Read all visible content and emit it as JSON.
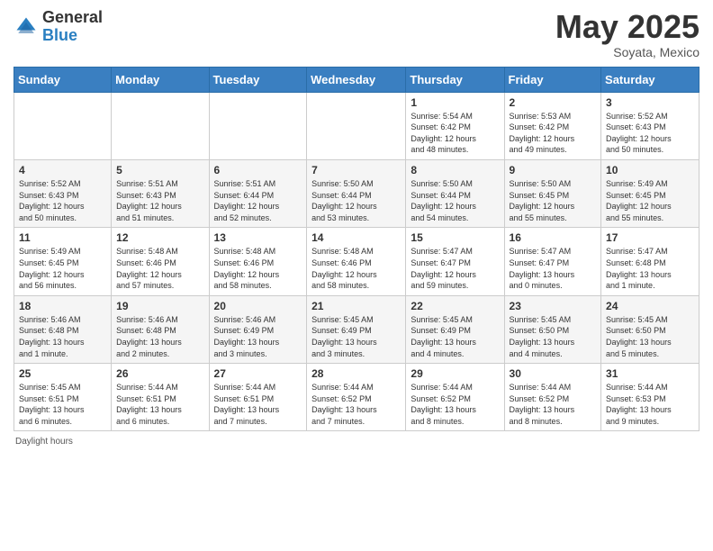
{
  "header": {
    "logo_general": "General",
    "logo_blue": "Blue",
    "month_title": "May 2025",
    "location": "Soyata, Mexico"
  },
  "days_of_week": [
    "Sunday",
    "Monday",
    "Tuesday",
    "Wednesday",
    "Thursday",
    "Friday",
    "Saturday"
  ],
  "weeks": [
    [
      {
        "day": "",
        "info": ""
      },
      {
        "day": "",
        "info": ""
      },
      {
        "day": "",
        "info": ""
      },
      {
        "day": "",
        "info": ""
      },
      {
        "day": "1",
        "info": "Sunrise: 5:54 AM\nSunset: 6:42 PM\nDaylight: 12 hours\nand 48 minutes."
      },
      {
        "day": "2",
        "info": "Sunrise: 5:53 AM\nSunset: 6:42 PM\nDaylight: 12 hours\nand 49 minutes."
      },
      {
        "day": "3",
        "info": "Sunrise: 5:52 AM\nSunset: 6:43 PM\nDaylight: 12 hours\nand 50 minutes."
      }
    ],
    [
      {
        "day": "4",
        "info": "Sunrise: 5:52 AM\nSunset: 6:43 PM\nDaylight: 12 hours\nand 50 minutes."
      },
      {
        "day": "5",
        "info": "Sunrise: 5:51 AM\nSunset: 6:43 PM\nDaylight: 12 hours\nand 51 minutes."
      },
      {
        "day": "6",
        "info": "Sunrise: 5:51 AM\nSunset: 6:44 PM\nDaylight: 12 hours\nand 52 minutes."
      },
      {
        "day": "7",
        "info": "Sunrise: 5:50 AM\nSunset: 6:44 PM\nDaylight: 12 hours\nand 53 minutes."
      },
      {
        "day": "8",
        "info": "Sunrise: 5:50 AM\nSunset: 6:44 PM\nDaylight: 12 hours\nand 54 minutes."
      },
      {
        "day": "9",
        "info": "Sunrise: 5:50 AM\nSunset: 6:45 PM\nDaylight: 12 hours\nand 55 minutes."
      },
      {
        "day": "10",
        "info": "Sunrise: 5:49 AM\nSunset: 6:45 PM\nDaylight: 12 hours\nand 55 minutes."
      }
    ],
    [
      {
        "day": "11",
        "info": "Sunrise: 5:49 AM\nSunset: 6:45 PM\nDaylight: 12 hours\nand 56 minutes."
      },
      {
        "day": "12",
        "info": "Sunrise: 5:48 AM\nSunset: 6:46 PM\nDaylight: 12 hours\nand 57 minutes."
      },
      {
        "day": "13",
        "info": "Sunrise: 5:48 AM\nSunset: 6:46 PM\nDaylight: 12 hours\nand 58 minutes."
      },
      {
        "day": "14",
        "info": "Sunrise: 5:48 AM\nSunset: 6:46 PM\nDaylight: 12 hours\nand 58 minutes."
      },
      {
        "day": "15",
        "info": "Sunrise: 5:47 AM\nSunset: 6:47 PM\nDaylight: 12 hours\nand 59 minutes."
      },
      {
        "day": "16",
        "info": "Sunrise: 5:47 AM\nSunset: 6:47 PM\nDaylight: 13 hours\nand 0 minutes."
      },
      {
        "day": "17",
        "info": "Sunrise: 5:47 AM\nSunset: 6:48 PM\nDaylight: 13 hours\nand 1 minute."
      }
    ],
    [
      {
        "day": "18",
        "info": "Sunrise: 5:46 AM\nSunset: 6:48 PM\nDaylight: 13 hours\nand 1 minute."
      },
      {
        "day": "19",
        "info": "Sunrise: 5:46 AM\nSunset: 6:48 PM\nDaylight: 13 hours\nand 2 minutes."
      },
      {
        "day": "20",
        "info": "Sunrise: 5:46 AM\nSunset: 6:49 PM\nDaylight: 13 hours\nand 3 minutes."
      },
      {
        "day": "21",
        "info": "Sunrise: 5:45 AM\nSunset: 6:49 PM\nDaylight: 13 hours\nand 3 minutes."
      },
      {
        "day": "22",
        "info": "Sunrise: 5:45 AM\nSunset: 6:49 PM\nDaylight: 13 hours\nand 4 minutes."
      },
      {
        "day": "23",
        "info": "Sunrise: 5:45 AM\nSunset: 6:50 PM\nDaylight: 13 hours\nand 4 minutes."
      },
      {
        "day": "24",
        "info": "Sunrise: 5:45 AM\nSunset: 6:50 PM\nDaylight: 13 hours\nand 5 minutes."
      }
    ],
    [
      {
        "day": "25",
        "info": "Sunrise: 5:45 AM\nSunset: 6:51 PM\nDaylight: 13 hours\nand 6 minutes."
      },
      {
        "day": "26",
        "info": "Sunrise: 5:44 AM\nSunset: 6:51 PM\nDaylight: 13 hours\nand 6 minutes."
      },
      {
        "day": "27",
        "info": "Sunrise: 5:44 AM\nSunset: 6:51 PM\nDaylight: 13 hours\nand 7 minutes."
      },
      {
        "day": "28",
        "info": "Sunrise: 5:44 AM\nSunset: 6:52 PM\nDaylight: 13 hours\nand 7 minutes."
      },
      {
        "day": "29",
        "info": "Sunrise: 5:44 AM\nSunset: 6:52 PM\nDaylight: 13 hours\nand 8 minutes."
      },
      {
        "day": "30",
        "info": "Sunrise: 5:44 AM\nSunset: 6:52 PM\nDaylight: 13 hours\nand 8 minutes."
      },
      {
        "day": "31",
        "info": "Sunrise: 5:44 AM\nSunset: 6:53 PM\nDaylight: 13 hours\nand 9 minutes."
      }
    ]
  ],
  "footer": {
    "daylight_label": "Daylight hours"
  }
}
